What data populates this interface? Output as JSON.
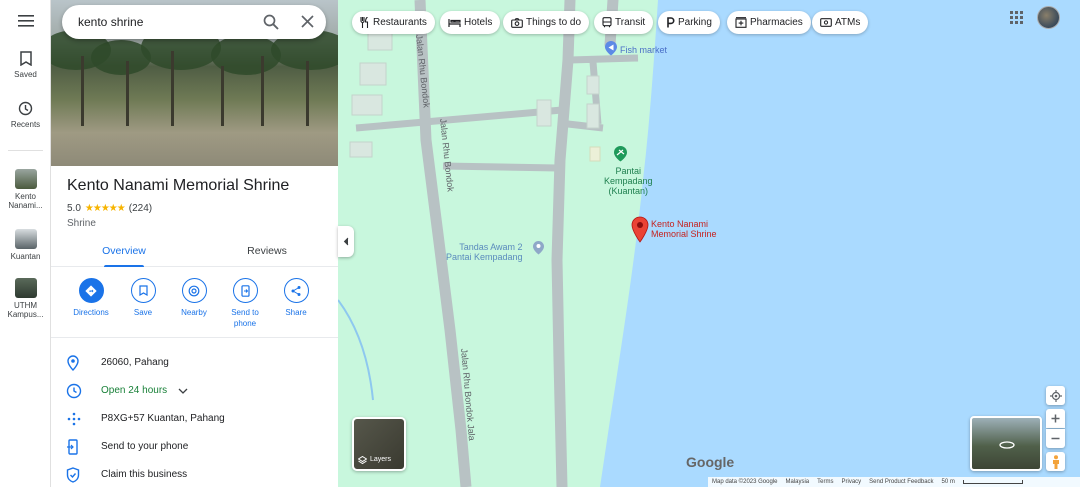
{
  "search": {
    "value": "kento shrine"
  },
  "rail": {
    "saved_label": "Saved",
    "recents_label": "Recents",
    "recent_items": [
      {
        "label": "Kento Nanami..."
      },
      {
        "label": "Kuantan"
      },
      {
        "label": "UTHM Kampus..."
      }
    ]
  },
  "place": {
    "title": "Kento Nanami Memorial Shrine",
    "rating": "5.0",
    "reviews_count": "(224)",
    "category": "Shrine",
    "tabs": [
      {
        "label": "Overview"
      },
      {
        "label": "Reviews"
      }
    ],
    "actions": [
      {
        "label": "Directions"
      },
      {
        "label": "Save"
      },
      {
        "label": "Nearby"
      },
      {
        "label": "Send to phone"
      },
      {
        "label": "Share"
      }
    ],
    "address": "26060, Pahang",
    "hours": "Open 24 hours",
    "plus_code": "P8XG+57 Kuantan, Pahang",
    "send_to_phone": "Send to your phone",
    "claim": "Claim this business"
  },
  "map": {
    "chips": [
      {
        "label": "Restaurants",
        "icon": "fork-knife-icon"
      },
      {
        "label": "Hotels",
        "icon": "bed-icon"
      },
      {
        "label": "Things to do",
        "icon": "camera-icon"
      },
      {
        "label": "Transit",
        "icon": "bus-icon"
      },
      {
        "label": "Parking",
        "icon": "parking-icon"
      },
      {
        "label": "Pharmacies",
        "icon": "pharmacy-icon"
      },
      {
        "label": "ATMs",
        "icon": "atm-icon"
      }
    ],
    "labels": {
      "fish_market": "Fish market",
      "pantai_line1": "Pantai",
      "pantai_line2": "Kempadang",
      "pantai_line3": "(Kuantan)",
      "tandas_line1": "Tandas Awam 2",
      "tandas_line2": "Pantai Kempadang",
      "pin_line1": "Kento Nanami",
      "pin_line2": "Memorial Shrine",
      "road_1": "Jalan Rhu Bondok",
      "road_2": "Jalan Rhu Bondok",
      "road_3": "Jalan Rhu Bondok Jala"
    },
    "layers_label": "Layers",
    "google_logo": "Google",
    "footer": {
      "map_data": "Map data ©2023 Google",
      "country": "Malaysia",
      "terms": "Terms",
      "privacy": "Privacy",
      "feedback": "Send Product Feedback",
      "scale": "50 m"
    }
  },
  "colors": {
    "accent": "#1a73e8",
    "land": "#c8f7dd",
    "water": "#aadaff",
    "pin": "#ea4335",
    "star": "#f7b400"
  }
}
